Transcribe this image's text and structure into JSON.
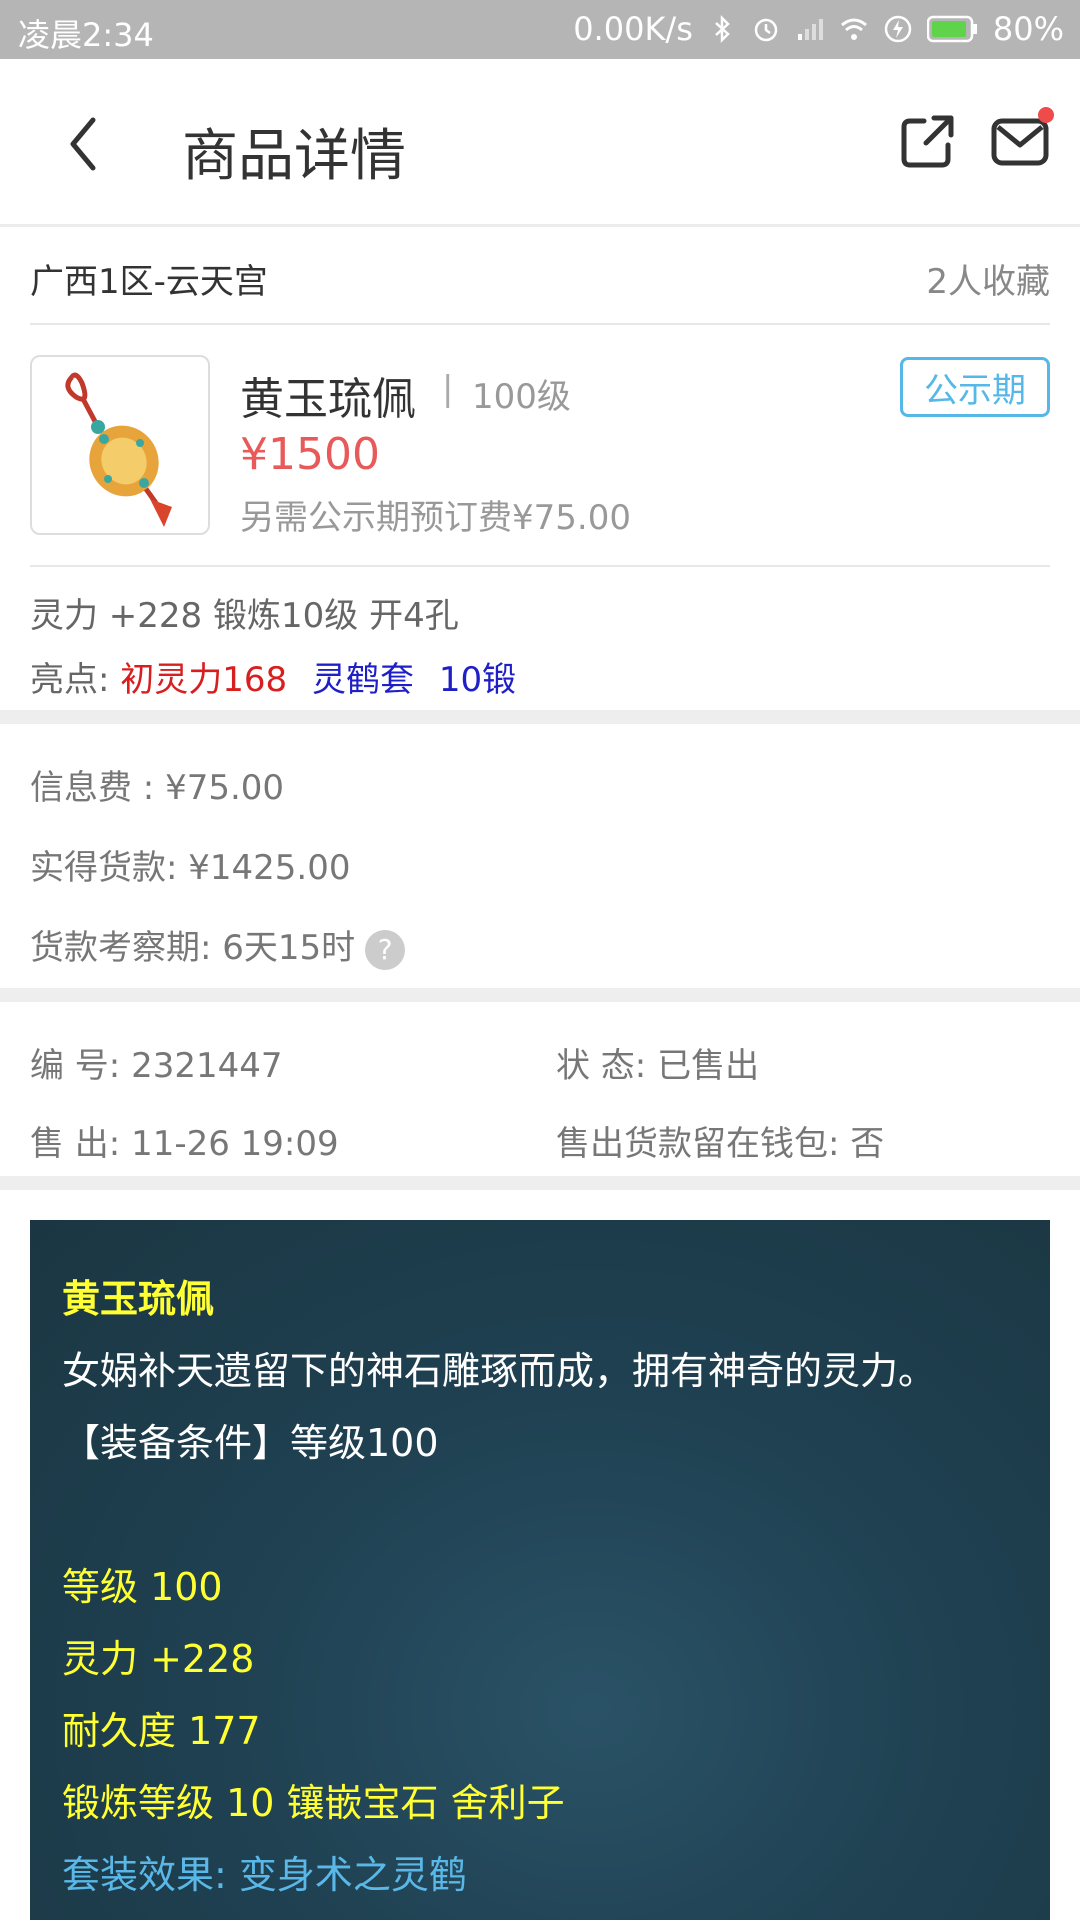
{
  "status_bar": {
    "time": "凌晨2:34",
    "net_speed": "0.00K/s",
    "battery": "80%"
  },
  "header": {
    "title": "商品详情"
  },
  "server": {
    "name": "广西1区-云天宫",
    "favorites": "2人收藏"
  },
  "product": {
    "name": "黄玉琉佩",
    "separator": "|",
    "level": "100级",
    "price": "¥1500",
    "extra_fee": "另需公示期预订费¥75.00",
    "badge": "公示期",
    "attrs": "灵力 +228 锻炼10级 开4孔",
    "highlights_label": "亮点:",
    "highlights": [
      "初灵力168",
      "灵鹤套",
      "10锻"
    ]
  },
  "fees": {
    "info_fee": "信息费 : ¥75.00",
    "actual_payment": "实得货款: ¥1425.00",
    "review_period": "货款考察期: 6天15时",
    "help": "?"
  },
  "order": {
    "number": "编  号: 2321447",
    "status": "状  态: 已售出",
    "sold_at": "售  出: 11-26 19:09",
    "wallet": "售出货款留在钱包: 否"
  },
  "description": {
    "title": "黄玉琉佩",
    "intro": "女娲补天遗留下的神石雕琢而成，拥有神奇的灵力。",
    "requirement": "【装备条件】等级100",
    "level": "等级 100",
    "spirit": "灵力 +228",
    "durability": "耐久度 177",
    "forge": "锻炼等级 10 镶嵌宝石 舍利子",
    "set_effect": "套装效果: 变身术之灵鹤"
  },
  "colors": {
    "price": "#e85a5a",
    "badge": "#56b8e8",
    "highlight_red": "#d81e1e",
    "highlight_blue": "#1f1fc8",
    "desc_yellow": "#ffff33",
    "desc_cyan": "#5ab8e8"
  },
  "icons": {
    "back": "chevron-left-icon",
    "share": "share-external-icon",
    "mail": "mail-icon",
    "help": "question-circle-icon",
    "item": "jade-pendant-image"
  }
}
